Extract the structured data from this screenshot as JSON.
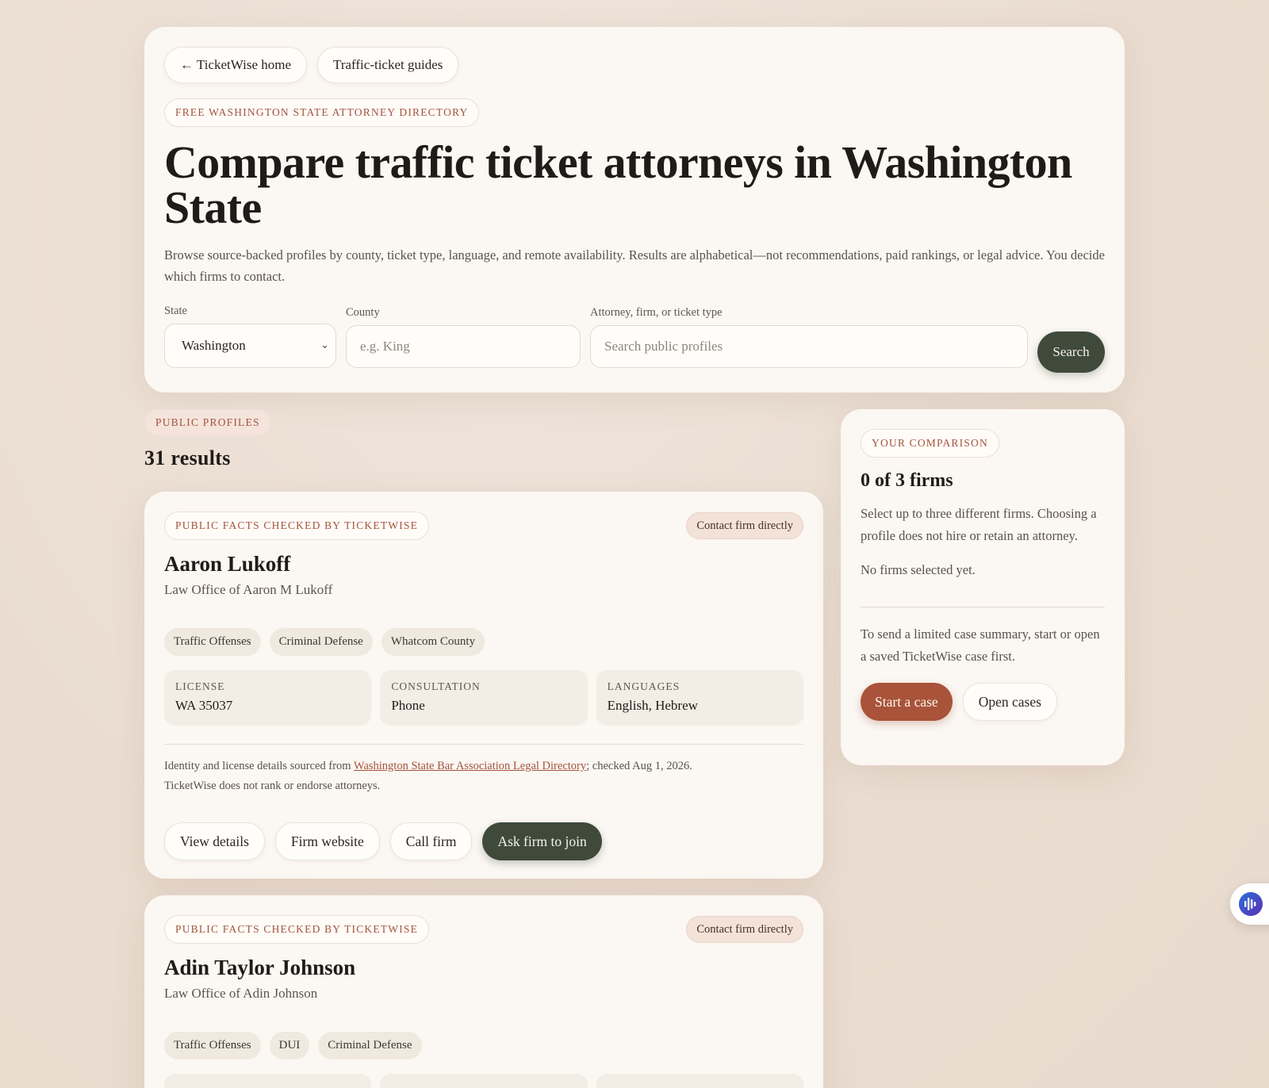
{
  "nav": {
    "home_label": "← TicketWise home",
    "guides_label": "Traffic-ticket guides"
  },
  "hero": {
    "eyebrow": "FREE WASHINGTON STATE ATTORNEY DIRECTORY",
    "title": "Compare traffic ticket attorneys in Washington State",
    "lede": "Browse source-backed profiles by county, ticket type, language, and remote availability. Results are alphabetical—not recommendations, paid rankings, or legal advice. You decide which firms to contact."
  },
  "filters": {
    "state_label": "State",
    "state_value": "Washington",
    "county_label": "County",
    "county_placeholder": "e.g. King",
    "query_label": "Attorney, firm, or ticket type",
    "query_placeholder": "Search public profiles",
    "search_label": "Search"
  },
  "results": {
    "eyebrow": "PUBLIC PROFILES",
    "count": "31 results"
  },
  "profiles": [
    {
      "eyebrow": "PUBLIC FACTS CHECKED BY TICKETWISE",
      "badge": "Contact firm directly",
      "name": "Aaron Lukoff",
      "firm": "Law Office of Aaron M Lukoff",
      "tags": [
        "Traffic Offenses",
        "Criminal Defense",
        "Whatcom County"
      ],
      "facts": [
        {
          "label": "LICENSE",
          "value": "WA 35037"
        },
        {
          "label": "CONSULTATION",
          "value": "Phone"
        },
        {
          "label": "LANGUAGES",
          "value": "English, Hebrew"
        }
      ],
      "source_prefix": "Identity and license details sourced from ",
      "source_link": "Washington State Bar Association Legal Directory",
      "source_suffix": "; checked Aug 1, 2026.",
      "source_note": "TicketWise does not rank or endorse attorneys.",
      "actions": {
        "details": "View details",
        "website": "Firm website",
        "call": "Call firm",
        "join": "Ask firm to join"
      }
    },
    {
      "eyebrow": "PUBLIC FACTS CHECKED BY TICKETWISE",
      "badge": "Contact firm directly",
      "name": "Adin Taylor Johnson",
      "firm": "Law Office of Adin Johnson",
      "tags": [
        "Traffic Offenses",
        "DUI",
        "Criminal Defense"
      ]
    }
  ],
  "comparison": {
    "eyebrow": "YOUR COMPARISON",
    "title": "0 of 3 firms",
    "text": "Select up to three different firms. Choosing a profile does not hire or retain an attorney.",
    "empty": "No firms selected yet.",
    "send_text": "To send a limited case summary, start or open a saved TicketWise case first.",
    "start_label": "Start a case",
    "open_label": "Open cases"
  },
  "widget": {
    "icon": "audio-assistant-icon"
  },
  "colors": {
    "accent_rust": "#a8533a",
    "accent_dark_green": "#3f4a3b",
    "eyebrow_text": "#a3533c",
    "card_bg": "#fbf7f2",
    "page_bg": "#ecdfd4"
  }
}
